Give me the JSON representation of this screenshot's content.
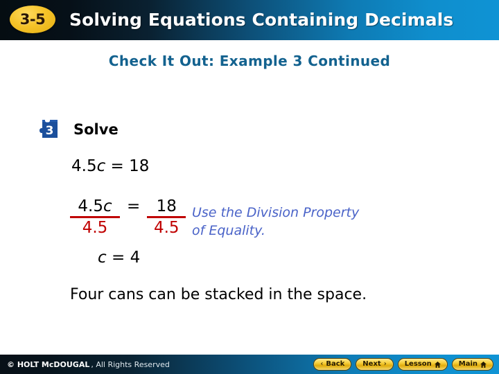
{
  "header": {
    "badge": "3-5",
    "title": "Solving Equations Containing Decimals",
    "gradient_start": "#050d12",
    "gradient_end": "#0f93d4",
    "badge_color": "#f5c329",
    "title_color": "#ffffff"
  },
  "subtitle": {
    "text": "Check It Out: Example 3 Continued",
    "color": "#13628f"
  },
  "step": {
    "number": "3",
    "label": "Solve",
    "icon": "puzzle-piece-icon",
    "icon_color": "#1b4f9c"
  },
  "math": {
    "equation_1": {
      "left_coefficient": "4.5",
      "variable": "c",
      "operator": "=",
      "right": "18",
      "full": "4.5c = 18"
    },
    "division_step": {
      "left_numerator_coefficient": "4.5",
      "left_numerator_variable": "c",
      "left_denominator": "4.5",
      "operator": "=",
      "right_numerator": "18",
      "right_denominator": "4.5",
      "bar_color": "#c00000",
      "denominator_color": "#c00000"
    },
    "equation_2": {
      "variable": "c",
      "operator": "=",
      "value": "4",
      "full": "c = 4"
    }
  },
  "note": {
    "line_1": "Use the Division Property",
    "line_2": "of Equality.",
    "color": "#4a63c8"
  },
  "conclusion": {
    "text": "Four cans can be stacked in the space."
  },
  "footer": {
    "copyright_brand": "© HOLT McDOUGAL",
    "copyright_rest": ", All Rights Reserved",
    "buttons": [
      {
        "label": "Back",
        "icon": "chevron-left-icon",
        "glyph": "‹"
      },
      {
        "label": "Next",
        "icon": "chevron-right-icon",
        "glyph": "›"
      },
      {
        "label": "Lesson",
        "icon": "home-icon",
        "glyph": ""
      },
      {
        "label": "Main",
        "icon": "home-icon",
        "glyph": ""
      }
    ],
    "button_color": "#f0c822"
  }
}
